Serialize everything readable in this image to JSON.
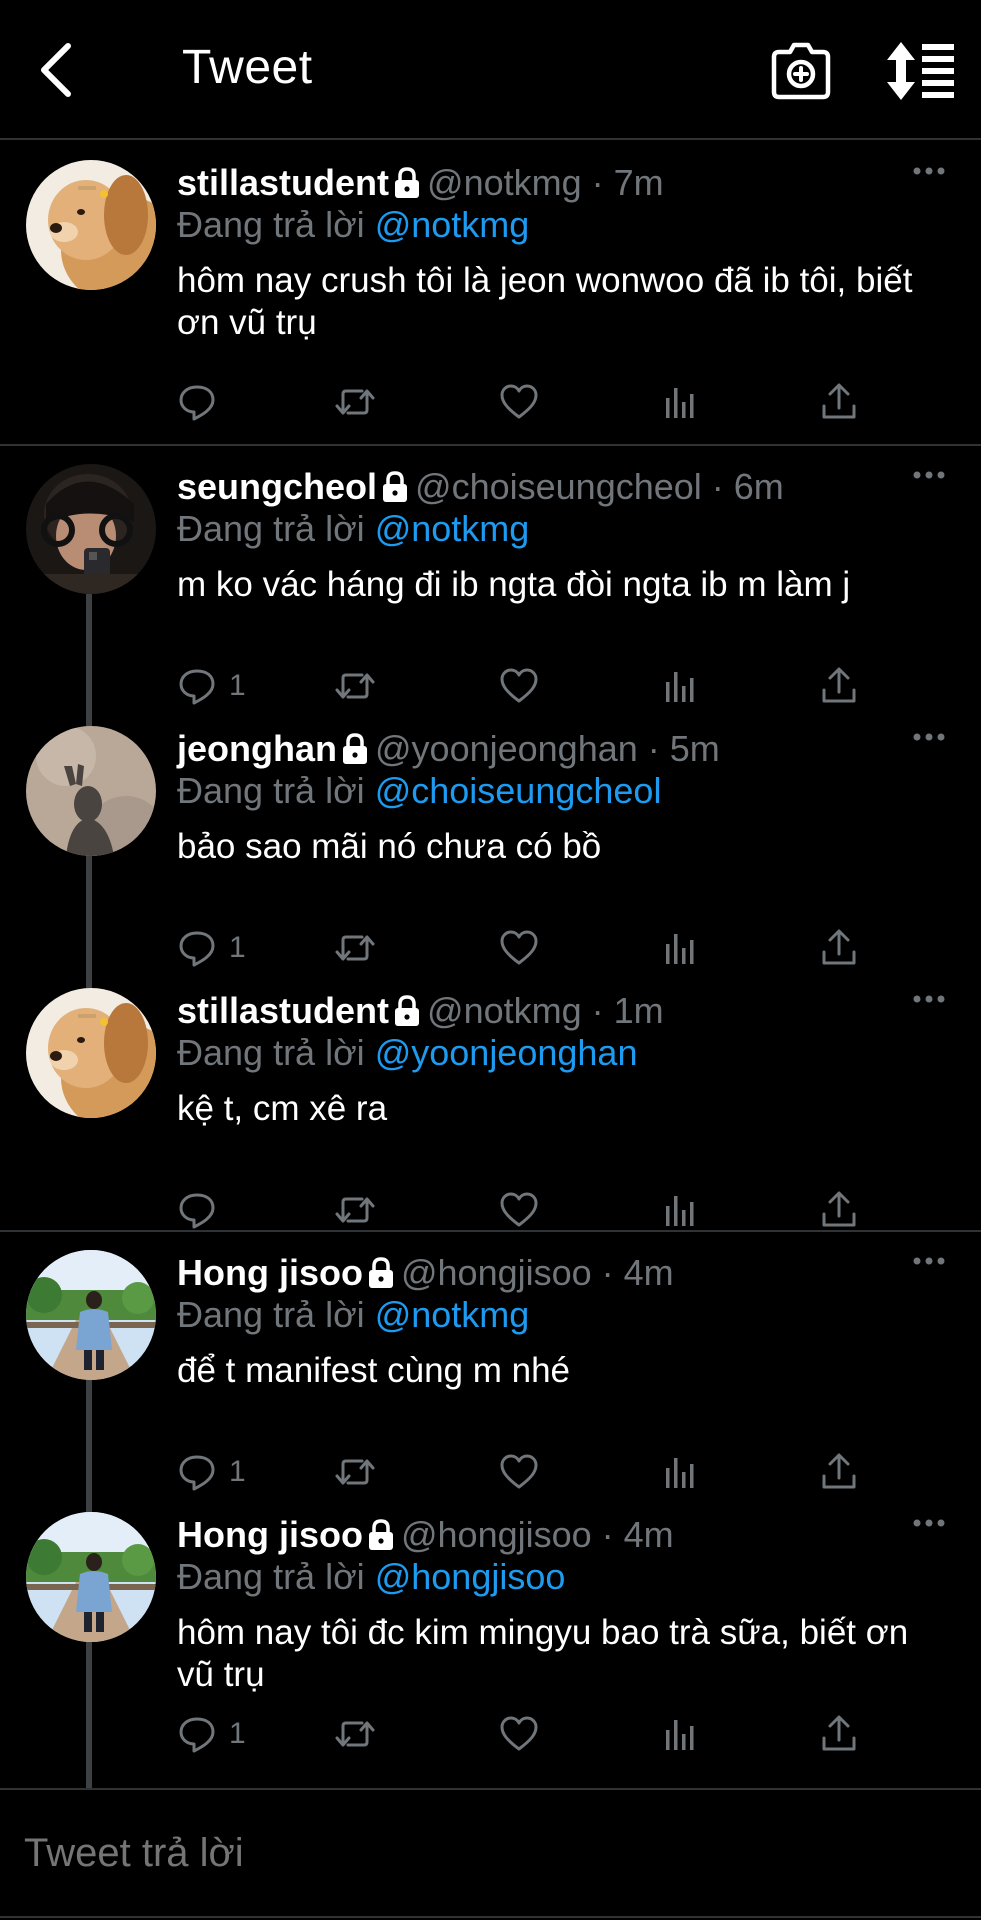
{
  "header": {
    "title": "Tweet",
    "back_icon": "chevron-left-icon",
    "camera_icon": "camera-plus-icon",
    "sort_icon": "sort-icon"
  },
  "tweets": [
    {
      "name": "stillastudent",
      "handle": "@notkmg",
      "time": "· 7m",
      "replying_prefix": "Đang trả lời",
      "replying_to": "@notkmg",
      "text": "hôm nay crush tôi là jeon wonwoo đã ib tôi, biết ơn vũ trụ",
      "reply_count": "",
      "avatar": "dog-avatar"
    },
    {
      "name": "seungcheol",
      "handle": "@choiseungcheol",
      "time": "· 6m",
      "replying_prefix": "Đang trả lời",
      "replying_to": "@notkmg",
      "text": "m ko vác háng đi ib ngta đòi ngta ib m làm j",
      "reply_count": "1",
      "avatar": "selfie-avatar"
    },
    {
      "name": "jeonghan",
      "handle": "@yoonjeonghan",
      "time": "· 5m",
      "replying_prefix": "Đang trả lời",
      "replying_to": "@choiseungcheol",
      "text": "bảo sao mãi nó chưa có bồ",
      "reply_count": "1",
      "avatar": "shadow-avatar"
    },
    {
      "name": "stillastudent",
      "handle": "@notkmg",
      "time": "· 1m",
      "replying_prefix": "Đang trả lời",
      "replying_to": "@yoonjeonghan",
      "text": "kệ t, cm xê ra",
      "reply_count": "",
      "avatar": "dog-avatar"
    },
    {
      "name": "Hong jisoo",
      "handle": "@hongjisoo",
      "time": "· 4m",
      "replying_prefix": "Đang trả lời",
      "replying_to": "@notkmg",
      "text": "để t manifest cùng m nhé",
      "reply_count": "1",
      "avatar": "park-avatar"
    },
    {
      "name": "Hong jisoo",
      "handle": "@hongjisoo",
      "time": "· 4m",
      "replying_prefix": "Đang trả lời",
      "replying_to": "@hongjisoo",
      "text": "hôm nay tôi đc kim mingyu bao trà sữa, biết ơn vũ trụ",
      "reply_count": "1",
      "avatar": "park-avatar"
    }
  ],
  "reply_bar": {
    "placeholder": "Tweet trả lời"
  },
  "colors": {
    "background": "#000000",
    "accent": "#1d9bf0",
    "muted": "#71767b",
    "divider": "#2f3336"
  }
}
